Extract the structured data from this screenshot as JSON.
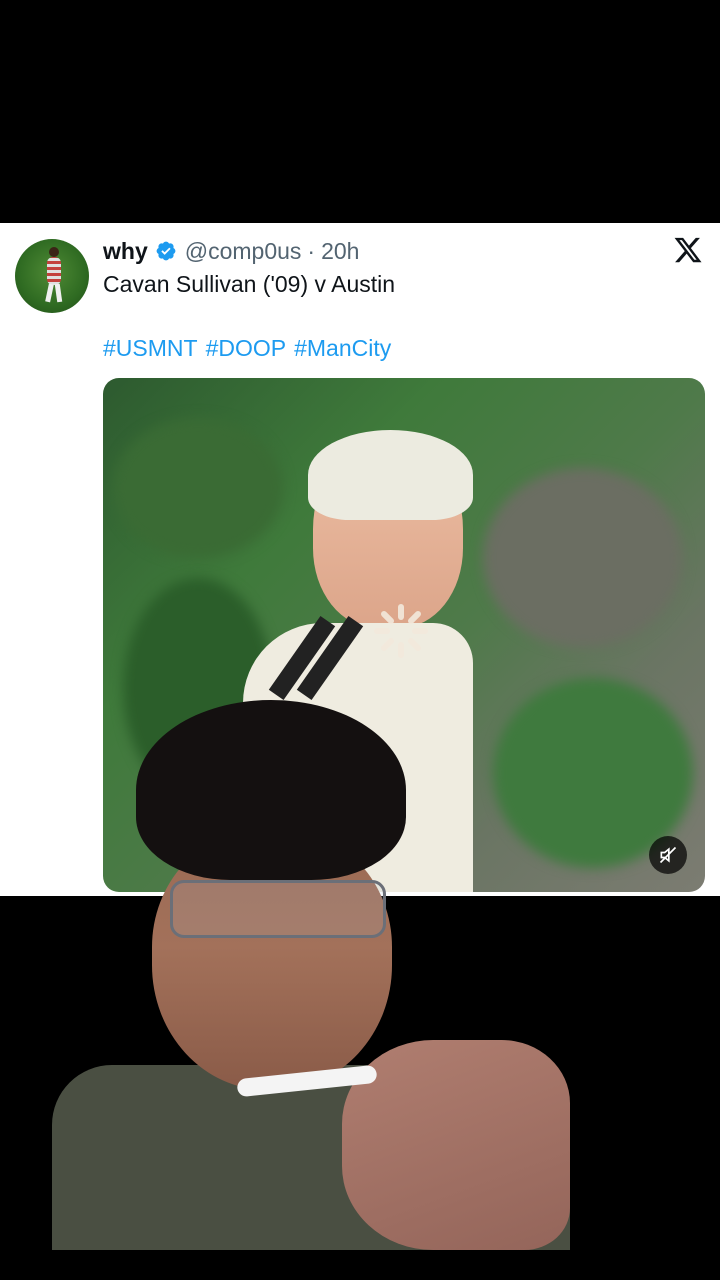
{
  "tweet": {
    "display_name": "why",
    "handle": "@comp0us",
    "separator": "·",
    "timestamp": "20h",
    "text": "Cavan Sullivan ('09) v Austin",
    "hashtags": [
      "#USMNT",
      "#DOOP",
      "#ManCity"
    ]
  },
  "colors": {
    "link": "#1d9bf0",
    "verified": "#1d9bf0",
    "secondary_text": "#536471",
    "primary_text": "#0f1419"
  },
  "icons": {
    "verified": "verified-badge-icon",
    "brand": "x-logo-icon",
    "mute": "muted-speaker-icon",
    "loading": "loading-spinner-icon"
  }
}
